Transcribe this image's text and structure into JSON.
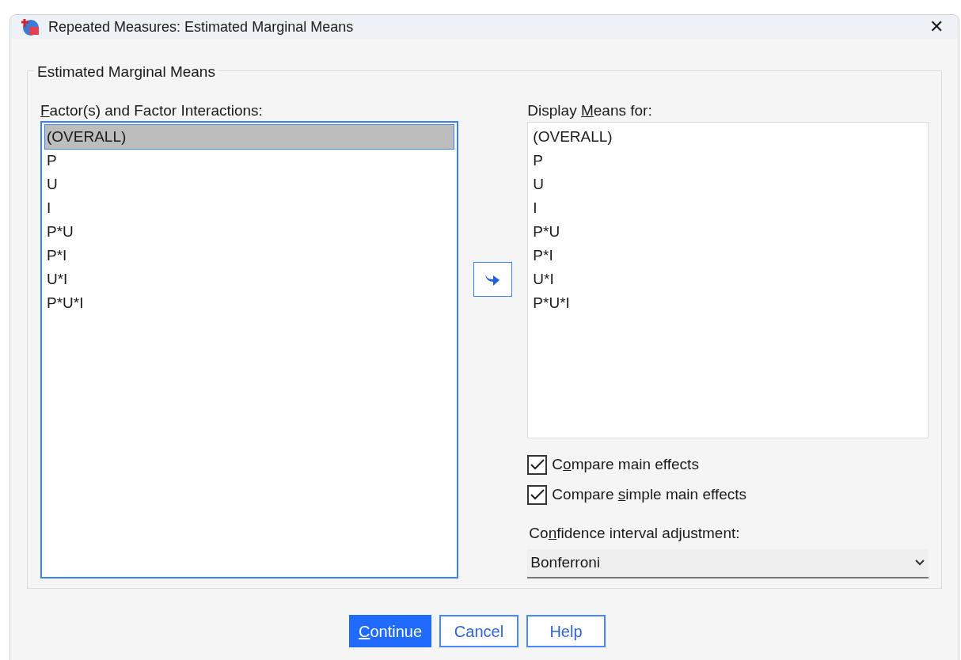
{
  "window": {
    "title": "Repeated Measures: Estimated Marginal Means",
    "close": "✕"
  },
  "group": {
    "title": "Estimated Marginal Means"
  },
  "factors": {
    "label": {
      "key": "F",
      "post": "actor(s) and Factor Interactions:"
    },
    "items": [
      {
        "text": "(OVERALL)",
        "selected": true
      },
      {
        "text": "P",
        "selected": false
      },
      {
        "text": "U",
        "selected": false
      },
      {
        "text": "I",
        "selected": false
      },
      {
        "text": "P*U",
        "selected": false
      },
      {
        "text": "P*I",
        "selected": false
      },
      {
        "text": "U*I",
        "selected": false
      },
      {
        "text": "P*U*I",
        "selected": false
      }
    ]
  },
  "display_means": {
    "label": {
      "pre": "Display ",
      "key": "M",
      "post": "eans for:"
    },
    "items": [
      {
        "text": "(OVERALL)",
        "selected": false
      },
      {
        "text": "P",
        "selected": false
      },
      {
        "text": "U",
        "selected": false
      },
      {
        "text": "I",
        "selected": false
      },
      {
        "text": "P*U",
        "selected": false
      },
      {
        "text": "P*I",
        "selected": false
      },
      {
        "text": "U*I",
        "selected": false
      },
      {
        "text": "P*U*I",
        "selected": false
      }
    ]
  },
  "options": [
    {
      "label": {
        "pre": "C",
        "key": "o",
        "post": "mpare main effects"
      },
      "checked": true
    },
    {
      "label": {
        "pre": "Compare ",
        "key": "s",
        "post": "imple main effects"
      },
      "checked": true
    }
  ],
  "adjustment": {
    "label": {
      "pre": "Co",
      "key": "n",
      "post": "fidence interval adjustment:"
    },
    "value": "Bonferroni"
  },
  "buttons": [
    {
      "label": {
        "key": "C",
        "post": "ontinue"
      },
      "primary": true
    },
    {
      "label": {
        "pre": "Cancel"
      },
      "primary": false
    },
    {
      "label": {
        "pre": "Help"
      },
      "primary": false
    }
  ]
}
